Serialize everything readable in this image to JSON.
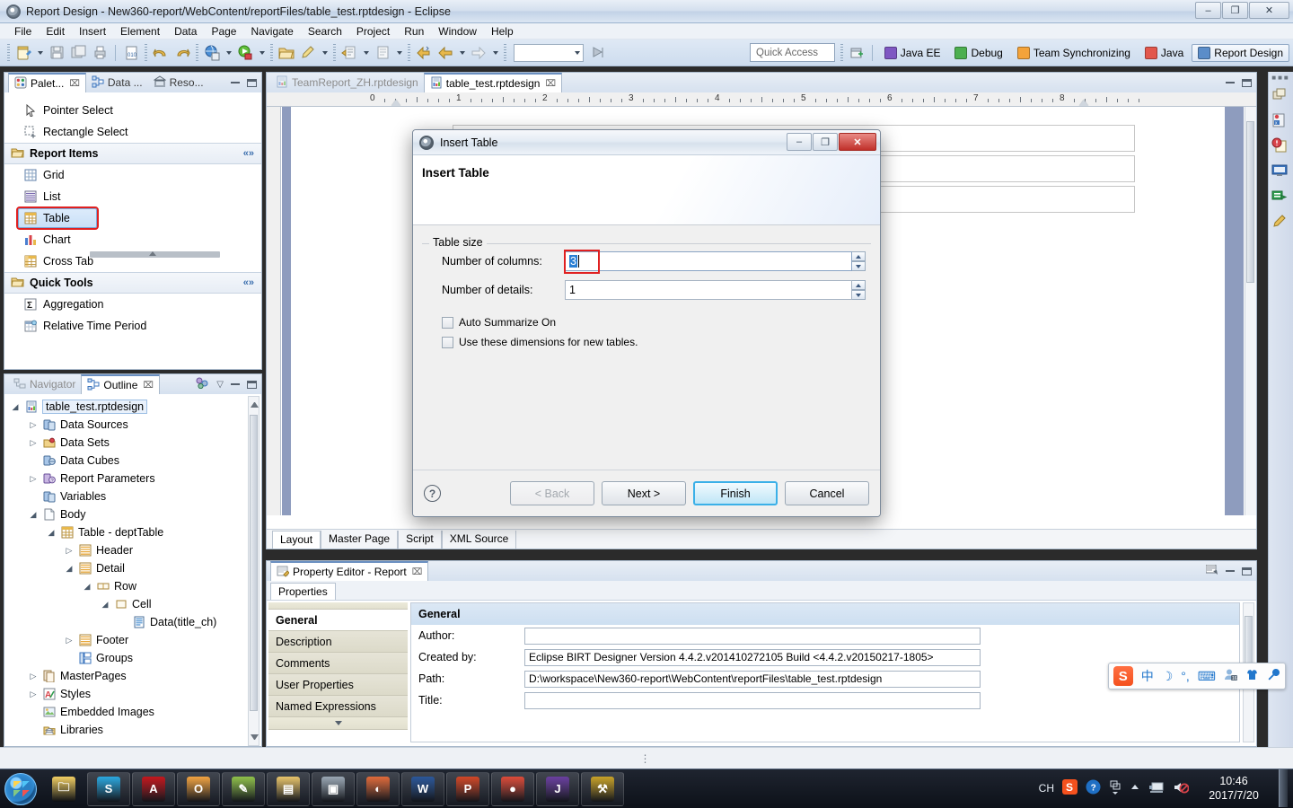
{
  "window": {
    "title": "Report Design - New360-report/WebContent/reportFiles/table_test.rptdesign - Eclipse",
    "minimize": "–",
    "maximize": "❐",
    "close": "✕"
  },
  "menu": [
    "File",
    "Edit",
    "Insert",
    "Element",
    "Data",
    "Page",
    "Navigate",
    "Search",
    "Project",
    "Run",
    "Window",
    "Help"
  ],
  "toolbar": {
    "quick_access_placeholder": "Quick Access",
    "perspectives": [
      {
        "label": "Java EE",
        "active": false
      },
      {
        "label": "Debug",
        "active": false
      },
      {
        "label": "Team Synchronizing",
        "active": false
      },
      {
        "label": "Java",
        "active": false
      },
      {
        "label": "Report Design",
        "active": true
      }
    ]
  },
  "palette": {
    "tabs": [
      {
        "label": "Palet...",
        "active": true,
        "close": "⌧"
      },
      {
        "label": "Data ...",
        "active": false
      },
      {
        "label": "Reso...",
        "active": false
      }
    ],
    "tools": [
      {
        "label": "Pointer Select",
        "icon": "pointer-icon"
      },
      {
        "label": "Rectangle Select",
        "icon": "marquee-icon"
      }
    ],
    "groups": [
      {
        "label": "Report Items",
        "items": [
          {
            "label": "Grid",
            "icon": "grid-icon",
            "selected": false
          },
          {
            "label": "List",
            "icon": "list-icon",
            "selected": false
          },
          {
            "label": "Table",
            "icon": "table-icon",
            "selected": true
          },
          {
            "label": "Chart",
            "icon": "chart-icon",
            "selected": false
          },
          {
            "label": "Cross Tab",
            "icon": "crosstab-icon",
            "selected": false
          }
        ]
      },
      {
        "label": "Quick Tools",
        "items": [
          {
            "label": "Aggregation",
            "icon": "sigma-icon",
            "selected": false
          },
          {
            "label": "Relative Time Period",
            "icon": "calendar-icon",
            "selected": false
          }
        ]
      }
    ]
  },
  "outline": {
    "tabs": [
      {
        "label": "Navigator",
        "active": false
      },
      {
        "label": "Outline",
        "active": true,
        "close": "⌧"
      }
    ],
    "nodes": [
      {
        "label": "table_test.rptdesign",
        "depth": 0,
        "twisty": "down",
        "icon": "report-icon",
        "selected": true
      },
      {
        "label": "Data Sources",
        "depth": 1,
        "twisty": "right",
        "icon": "datasource-icon"
      },
      {
        "label": "Data Sets",
        "depth": 1,
        "twisty": "right",
        "icon": "dataset-icon"
      },
      {
        "label": "Data Cubes",
        "depth": 1,
        "twisty": "none",
        "icon": "datacube-icon"
      },
      {
        "label": "Report Parameters",
        "depth": 1,
        "twisty": "right",
        "icon": "params-icon"
      },
      {
        "label": "Variables",
        "depth": 1,
        "twisty": "none",
        "icon": "variables-icon"
      },
      {
        "label": "Body",
        "depth": 1,
        "twisty": "down",
        "icon": "body-icon"
      },
      {
        "label": "Table - deptTable",
        "depth": 2,
        "twisty": "down",
        "icon": "table-icon"
      },
      {
        "label": "Header",
        "depth": 3,
        "twisty": "right",
        "icon": "band-icon"
      },
      {
        "label": "Detail",
        "depth": 3,
        "twisty": "down",
        "icon": "band-icon"
      },
      {
        "label": "Row",
        "depth": 4,
        "twisty": "down",
        "icon": "row-icon"
      },
      {
        "label": "Cell",
        "depth": 5,
        "twisty": "down",
        "icon": "cell-icon"
      },
      {
        "label": "Data(title_ch)",
        "depth": 6,
        "twisty": "none",
        "icon": "data-icon"
      },
      {
        "label": "Footer",
        "depth": 3,
        "twisty": "right",
        "icon": "band-icon"
      },
      {
        "label": "Groups",
        "depth": 3,
        "twisty": "none",
        "icon": "groups-icon"
      },
      {
        "label": "MasterPages",
        "depth": 1,
        "twisty": "right",
        "icon": "masterpages-icon"
      },
      {
        "label": "Styles",
        "depth": 1,
        "twisty": "right",
        "icon": "styles-icon"
      },
      {
        "label": "Embedded Images",
        "depth": 1,
        "twisty": "none",
        "icon": "images-icon"
      },
      {
        "label": "Libraries",
        "depth": 1,
        "twisty": "none",
        "icon": "libraries-icon"
      }
    ]
  },
  "editor": {
    "tabs": [
      {
        "label": "table_test.rptdesign",
        "active": true,
        "close": "⌧"
      },
      {
        "label": "TeamReport_ZH.rptdesign",
        "active": false
      }
    ],
    "ruler_ticks": [
      "0",
      "1",
      "2",
      "3",
      "4",
      "5",
      "6",
      "7",
      "8"
    ],
    "bottom_tabs": [
      {
        "label": "Layout",
        "active": true
      },
      {
        "label": "Master Page",
        "active": false
      },
      {
        "label": "Script",
        "active": false
      },
      {
        "label": "XML Source",
        "active": false
      }
    ]
  },
  "property_editor": {
    "view_title": "Property Editor - Report",
    "view_close": "⌧",
    "tab": "Properties",
    "categories": [
      {
        "label": "General",
        "active": true
      },
      {
        "label": "Description",
        "active": false
      },
      {
        "label": "Comments",
        "active": false
      },
      {
        "label": "User Properties",
        "active": false
      },
      {
        "label": "Named Expressions",
        "active": false
      }
    ],
    "section_title": "General",
    "fields": [
      {
        "label": "Author:",
        "value": ""
      },
      {
        "label": "Created by:",
        "value": "Eclipse BIRT Designer Version 4.4.2.v201410272105 Build  <4.4.2.v20150217-1805>"
      },
      {
        "label": "Path:",
        "value": "D:\\workspace\\New360-report\\WebContent\\reportFiles\\table_test.rptdesign"
      },
      {
        "label": "Title:",
        "value": ""
      }
    ]
  },
  "dialog": {
    "window_title": "Insert Table",
    "heading": "Insert Table",
    "group_label": "Table size",
    "fields": [
      {
        "label": "Number of columns:",
        "value": "3",
        "selected": true
      },
      {
        "label": "Number of details:",
        "value": "1",
        "selected": false
      }
    ],
    "checkboxes": [
      {
        "label": "Auto Summarize On",
        "checked": false
      },
      {
        "label": "Use these dimensions for new tables.",
        "checked": false
      }
    ],
    "help": "?",
    "buttons": [
      {
        "label": "< Back",
        "state": "disabled"
      },
      {
        "label": "Next >",
        "state": "normal"
      },
      {
        "label": "Finish",
        "state": "default"
      },
      {
        "label": "Cancel",
        "state": "normal"
      }
    ],
    "titlebar_buttons": {
      "minimize": "–",
      "maximize": "❐",
      "close": "✕"
    }
  },
  "ime": {
    "logo": "S",
    "items": [
      "中",
      "☽",
      "°,",
      "⌨",
      "⑨",
      "T",
      "ᴿ"
    ]
  },
  "taskbar": {
    "apps": [
      {
        "name": "explorer-icon",
        "glyph": "🗀",
        "color": "#f2cf63"
      },
      {
        "name": "skype-icon",
        "glyph": "S",
        "color": "#2aa8e0"
      },
      {
        "name": "acrobat-icon",
        "glyph": "A",
        "color": "#c4161c"
      },
      {
        "name": "outlook-icon",
        "glyph": "O",
        "color": "#f2a341"
      },
      {
        "name": "notepad-icon",
        "glyph": "✎",
        "color": "#8fc14a"
      },
      {
        "name": "filemanager-icon",
        "glyph": "▤",
        "color": "#e8c46a"
      },
      {
        "name": "monitor-icon",
        "glyph": "▣",
        "color": "#9aa7b4"
      },
      {
        "name": "paint-icon",
        "glyph": "◐",
        "color": "#e06a3a"
      },
      {
        "name": "word-icon",
        "glyph": "W",
        "color": "#2b579a"
      },
      {
        "name": "powerpoint-icon",
        "glyph": "P",
        "color": "#d24726"
      },
      {
        "name": "chrome-icon",
        "glyph": "●",
        "color": "#dd4b39"
      },
      {
        "name": "javaee-ide-icon",
        "glyph": "J",
        "color": "#6a3fa0"
      },
      {
        "name": "tools-icon",
        "glyph": "⚒",
        "color": "#c9a227"
      }
    ],
    "tray": {
      "language": "CH",
      "sogou": "S",
      "help": "?",
      "time": "10:46",
      "date": "2017/7/20"
    }
  }
}
